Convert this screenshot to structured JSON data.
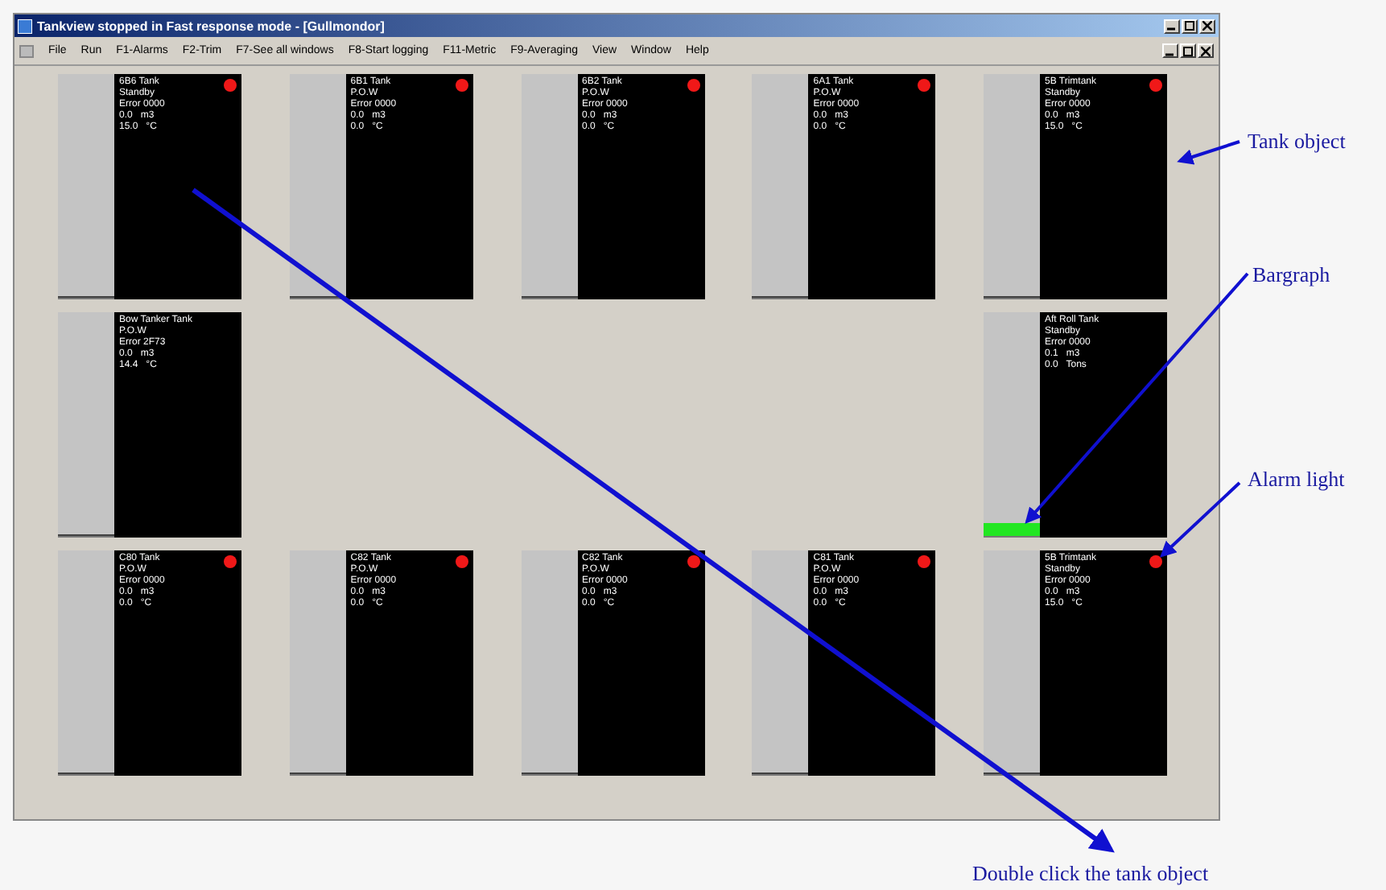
{
  "window": {
    "title": "Tankview stopped in Fast response mode - [Gullmondor]"
  },
  "menu": [
    "File",
    "Run",
    "F1-Alarms",
    "F2-Trim",
    "F7-See all windows",
    "F8-Start logging",
    "F11-Metric",
    "F9-Averaging",
    "View",
    "Window",
    "Help"
  ],
  "rows": [
    {
      "tanks": [
        {
          "lines": [
            "6B6 Tank",
            "Standby",
            "Error 0000",
            "0.0   m3",
            "15.0   °C"
          ],
          "alarm": true,
          "level": 0.01,
          "color": "#404040"
        },
        {
          "lines": [
            "6B1 Tank",
            "P.O.W",
            "Error 0000",
            "0.0   m3",
            "0.0   °C"
          ],
          "alarm": true,
          "level": 0.01,
          "color": "#404040"
        },
        {
          "lines": [
            "6B2 Tank",
            "P.O.W",
            "Error 0000",
            "0.0   m3",
            "0.0   °C"
          ],
          "alarm": true,
          "level": 0.01,
          "color": "#404040"
        },
        {
          "lines": [
            "6A1 Tank",
            "P.O.W",
            "Error 0000",
            "0.0   m3",
            "0.0   °C"
          ],
          "alarm": true,
          "level": 0.01,
          "color": "#404040"
        },
        {
          "lines": [
            "5B Trimtank",
            "Standby",
            "Error 0000",
            "0.0   m3",
            "15.0   °C"
          ],
          "alarm": true,
          "level": 0.01,
          "color": "#404040"
        }
      ]
    },
    {
      "tanks": [
        {
          "lines": [
            "Bow Tanker Tank",
            "P.O.W",
            "Error 2F73",
            "0.0   m3",
            "14.4   °C"
          ],
          "alarm": false,
          "level": 0.01,
          "color": "#404040"
        },
        {
          "lines": [
            "Aft Roll Tank",
            "Standby",
            "Error 0000",
            "0.1   m3",
            "0.0   Tons"
          ],
          "alarm": false,
          "level": 0.06,
          "color": "#22e622"
        }
      ]
    },
    {
      "tanks": [
        {
          "lines": [
            "C80 Tank",
            "P.O.W",
            "Error 0000",
            "0.0   m3",
            "0.0   °C"
          ],
          "alarm": true,
          "level": 0.01,
          "color": "#404040"
        },
        {
          "lines": [
            "C82 Tank",
            "P.O.W",
            "Error 0000",
            "0.0   m3",
            "0.0   °C"
          ],
          "alarm": true,
          "level": 0.01,
          "color": "#404040"
        },
        {
          "lines": [
            "C82 Tank",
            "P.O.W",
            "Error 0000",
            "0.0   m3",
            "0.0   °C"
          ],
          "alarm": true,
          "level": 0.01,
          "color": "#404040"
        },
        {
          "lines": [
            "C81 Tank",
            "P.O.W",
            "Error 0000",
            "0.0   m3",
            "0.0   °C"
          ],
          "alarm": true,
          "level": 0.01,
          "color": "#404040"
        },
        {
          "lines": [
            "5B Trimtank",
            "Standby",
            "Error 0000",
            "0.0   m3",
            "15.0   °C"
          ],
          "alarm": true,
          "level": 0.01,
          "color": "#404040"
        }
      ]
    }
  ],
  "annotations": [
    {
      "label": "Tank object"
    },
    {
      "label": "Bargraph"
    },
    {
      "label": "Alarm light"
    },
    {
      "label": "Double click the tank object"
    }
  ]
}
